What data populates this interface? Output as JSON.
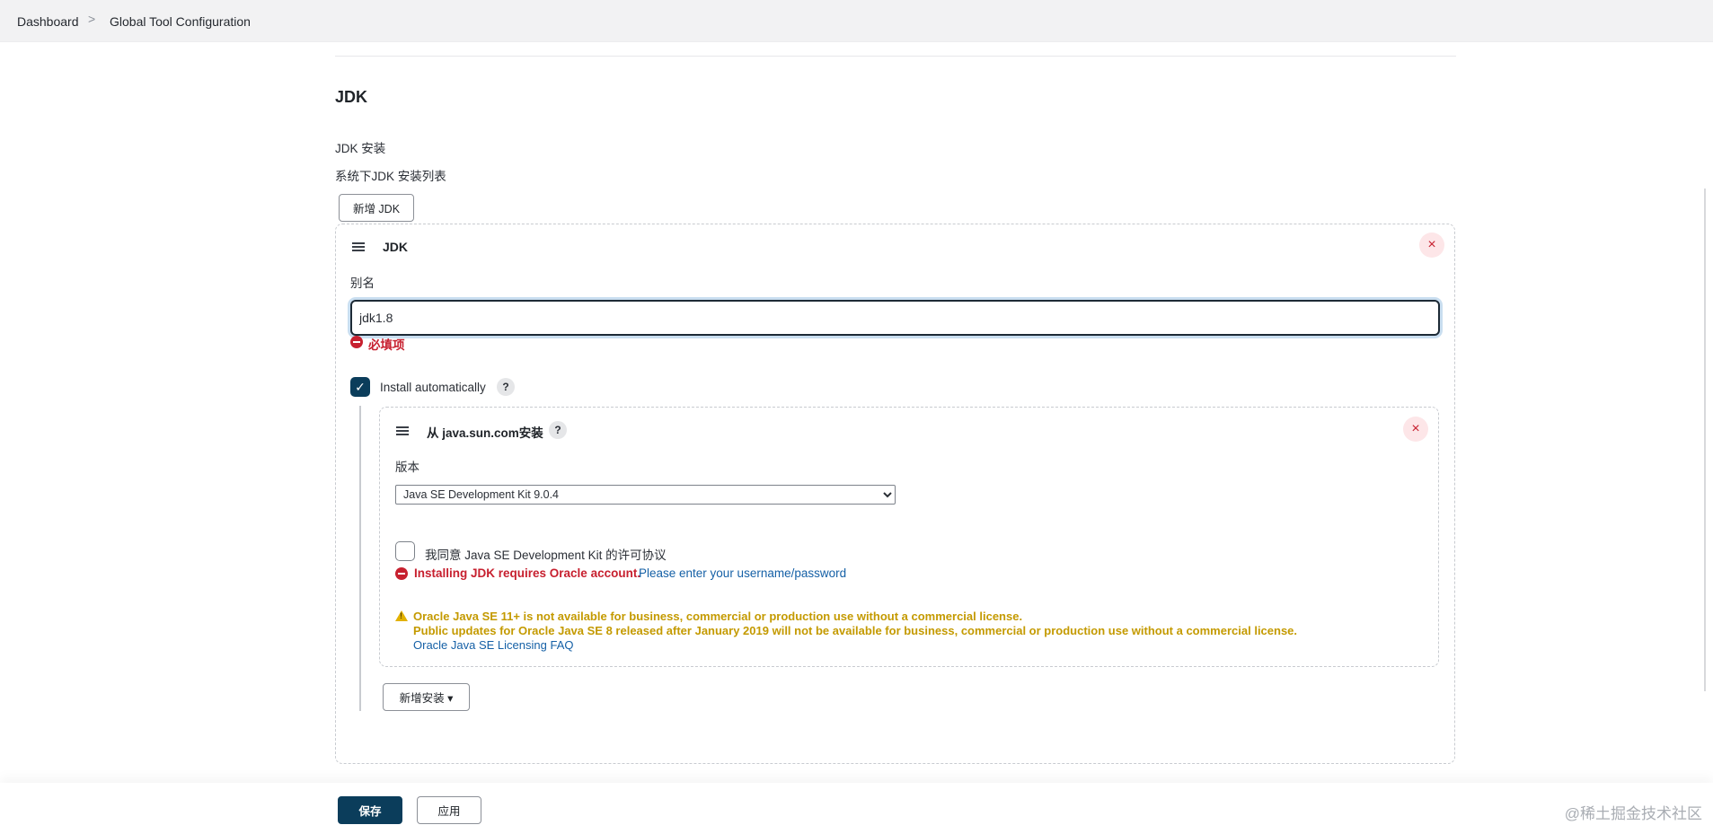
{
  "breadcrumb": {
    "dashboard": "Dashboard",
    "separator": ">",
    "current": "Global Tool Configuration"
  },
  "section": {
    "title": "JDK",
    "install_label": "JDK 安装",
    "install_desc": "系统下JDK 安装列表",
    "add_jdk_button": "新增 JDK"
  },
  "jdk_item": {
    "title": "JDK",
    "alias_label": "别名",
    "alias_value": "jdk1.8",
    "alias_error": "必填项",
    "install_auto_label": "Install automatically",
    "install_auto_checked": true,
    "help": "?",
    "close": "×",
    "installer": {
      "title": "从 java.sun.com安装",
      "help": "?",
      "close": "×",
      "version_label": "版本",
      "version_selected": "Java SE Development Kit 9.0.4",
      "agree_label": "我同意 Java SE Development Kit 的许可协议",
      "agree_checked": false,
      "oracle_error": "Installing JDK requires Oracle account.",
      "oracle_link": "Please enter your username/password",
      "warning_line1": "Oracle Java SE 11+ is not available for business, commercial or production use without a commercial license.",
      "warning_line2": "Public updates for Oracle Java SE 8 released after January 2019 will not be available for business, commercial or production use without a commercial license.",
      "faq_link": "Oracle Java SE Licensing FAQ"
    },
    "add_install_button": "新增安装 ▾"
  },
  "footer": {
    "save": "保存",
    "apply": "应用"
  },
  "watermark": "@稀土掘金技术社区",
  "colors": {
    "primary": "#0b3d5b",
    "error": "#c7202f",
    "warning": "#c49a00",
    "link": "#1560a6"
  },
  "icons": [
    "chevron-right-icon",
    "drag-handle-icon",
    "close-icon",
    "help-icon",
    "error-icon",
    "check-icon",
    "warning-icon"
  ]
}
